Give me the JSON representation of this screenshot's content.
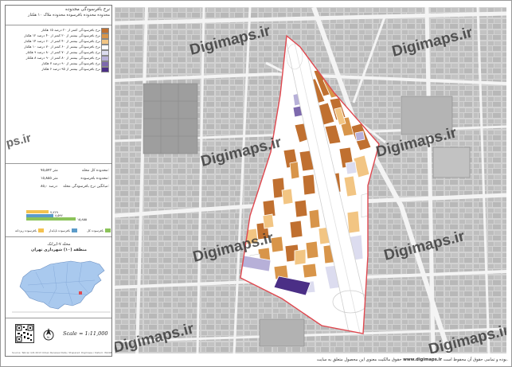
{
  "title": {
    "line1": "نرخ بافرسودگی محدوده",
    "line2": "محدوده محدوده بافرسوده محدوده ملاک ۱۰ هکتار"
  },
  "legend": [
    {
      "label": "نرخ بافرسودگی کمتر از ۲۰ درصد ۱۵ هکتار",
      "color": "#c07030"
    },
    {
      "label": "نرخ بافرسودگی بیشتر از ۲۰ کمتر از ۴۰ درصد ۱۲ هکتار",
      "color": "#d8954a"
    },
    {
      "label": "نرخ بافرسودگی بیشتر از ۴۰ کمتر از ۶۰ درصد ۱۴ هکتار",
      "color": "#f2c583"
    },
    {
      "label": "نرخ بافرسودگی بیشتر از ۶۰ کمتر از ۷۰ درصد ۱۰ هکتار",
      "color": "#ffffff"
    },
    {
      "label": "نرخ بافرسودگی بیشتر از ۷۰ کمتر از ۸۰ درصد ۹ هکتار",
      "color": "#dcdcef"
    },
    {
      "label": "نرخ بافرسودگی بیشتر از ۸۰ کمتر از ۹۰ درصد ۸ هکتار",
      "color": "#b7b0d8"
    },
    {
      "label": "نرخ بافرسودگی بیشتر از ۹۰ درصد ۷ هکتار",
      "color": "#7d69ad"
    },
    {
      "label": "نرخ بافرسودگی بیشتر از ۹۵ درصد ۶ هکتار",
      "color": "#4b2f86"
    }
  ],
  "stats": [
    {
      "label": "محدوده کل محله:",
      "value": "۷۵٫۵۷۲ متر"
    },
    {
      "label": "محدوده بافرسوده:",
      "value": "۱۵٫۸۵۵ متر"
    },
    {
      "label": "میانگین نرخ بافرسودگی محله:",
      "value": "۸۵٫۰ درصد"
    }
  ],
  "bars": [
    {
      "value": "۷٫۲۶۹",
      "fraction": 0.35,
      "color": "#f4c24f"
    },
    {
      "value": "۸٫۵۹۶",
      "fraction": 0.42,
      "color": "#5b9bc9"
    },
    {
      "value": "۱۵٫۸۵۵",
      "fraction": 0.78,
      "color": "#8cc35a"
    }
  ],
  "bar_legend": [
    {
      "label": "بافرسوده کل",
      "color": "#8cc35a"
    },
    {
      "label": "بافرسوده ناپایدار",
      "color": "#5b9bc9"
    },
    {
      "label": "بافرسوده ریزدانه",
      "color": "#f4c24f"
    }
  ],
  "region": {
    "line1": "محله ۷-ایرانک",
    "line2": "منطقه (۱۰) شهرداری تهران"
  },
  "scale": "Scale = 1:11,000",
  "credit": "Source: Tehran GIS 2013 Urban Renewal Data / Prepared: Digimaps / Datum: WGS84 UTM Zone 39N",
  "watermark": "Digimaps.ir",
  "watermark_short": "ps.ir",
  "footer": {
    "prefix": "حقوق مالکیت معنوی این محصول متعلق به سایت",
    "site": "www.digimaps.ir",
    "suffix": "بوده و تمامی حقوق آن محفوظ است."
  },
  "colors": {
    "boundary": "#e0484f",
    "map_bg": "#d8d8d8",
    "roads": "#ffffff",
    "blocks": "#b9b9b9"
  }
}
